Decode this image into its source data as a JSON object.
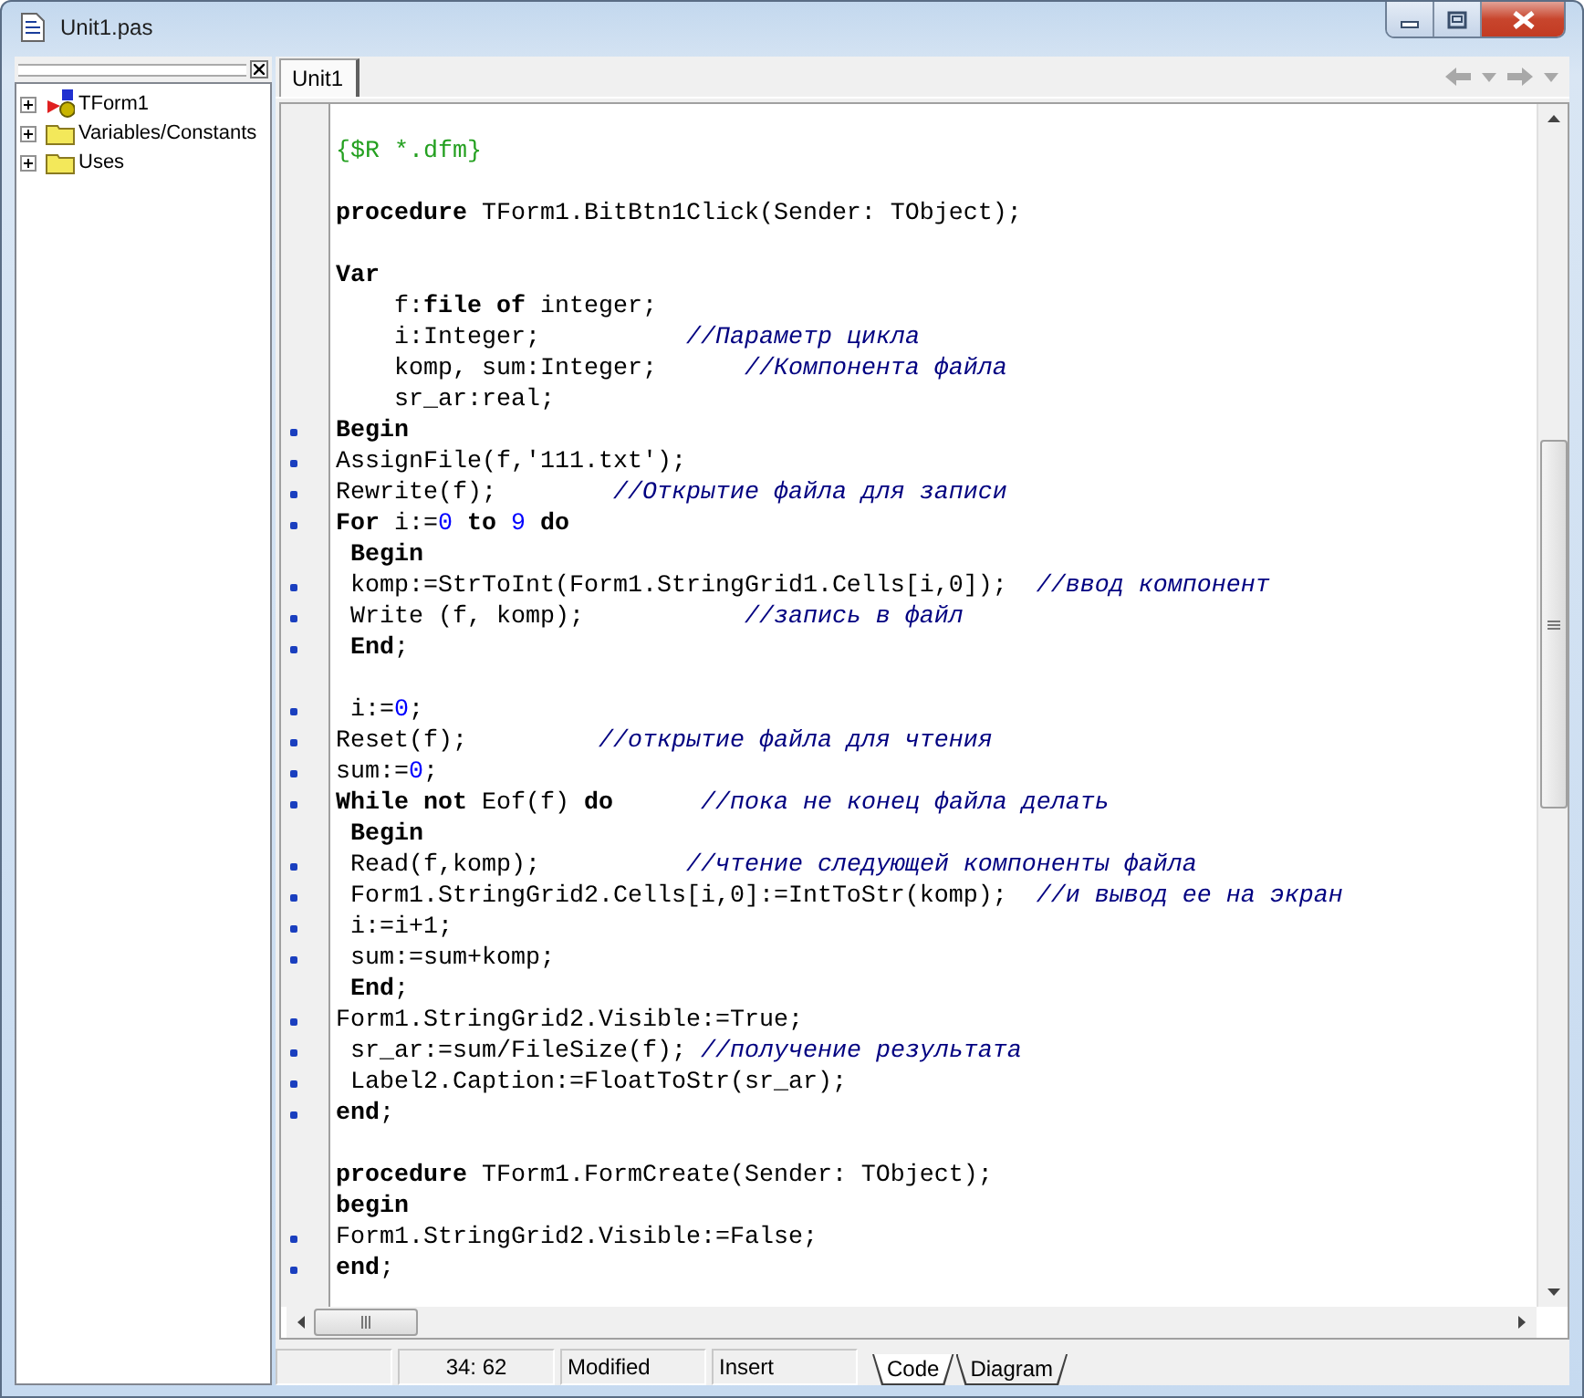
{
  "window": {
    "title": "Unit1.pas"
  },
  "structure_pane": {
    "items": [
      {
        "label": "TForm1",
        "kind": "form",
        "expanded": false
      },
      {
        "label": "Variables/Constants",
        "kind": "folder",
        "expanded": false
      },
      {
        "label": "Uses",
        "kind": "folder",
        "expanded": false
      }
    ]
  },
  "editor": {
    "tabs": [
      {
        "label": "Unit1",
        "selected": true
      }
    ],
    "code_lines": [
      {
        "marked": false
      },
      {
        "marked": false,
        "tokens": [
          {
            "kind": "directive",
            "text": "{$R *.dfm}"
          }
        ]
      },
      {
        "marked": false
      },
      {
        "marked": false,
        "tokens": [
          {
            "kind": "keyword",
            "text": "procedure"
          },
          {
            "kind": "plain",
            "text": " TForm1.BitBtn1Click(Sender: TObject);"
          }
        ]
      },
      {
        "marked": false
      },
      {
        "marked": false,
        "tokens": [
          {
            "kind": "keyword",
            "text": "Var"
          }
        ]
      },
      {
        "marked": false,
        "tokens": [
          {
            "kind": "plain",
            "text": "    f:"
          },
          {
            "kind": "keyword",
            "text": "file of"
          },
          {
            "kind": "plain",
            "text": " integer;"
          }
        ]
      },
      {
        "marked": false,
        "tokens": [
          {
            "kind": "plain",
            "text": "    i:Integer;          "
          },
          {
            "kind": "comment",
            "text": "//Параметр цикла"
          }
        ]
      },
      {
        "marked": false,
        "tokens": [
          {
            "kind": "plain",
            "text": "    komp, sum:Integer;      "
          },
          {
            "kind": "comment",
            "text": "//Компонента файла"
          }
        ]
      },
      {
        "marked": false,
        "tokens": [
          {
            "kind": "plain",
            "text": "    sr_ar:real;"
          }
        ]
      },
      {
        "marked": true,
        "tokens": [
          {
            "kind": "keyword",
            "text": "Begin"
          }
        ]
      },
      {
        "marked": true,
        "tokens": [
          {
            "kind": "plain",
            "text": "AssignFile(f,'111.txt');"
          }
        ]
      },
      {
        "marked": true,
        "tokens": [
          {
            "kind": "plain",
            "text": "Rewrite(f);        "
          },
          {
            "kind": "comment",
            "text": "//Открытие файла для записи"
          }
        ]
      },
      {
        "marked": true,
        "tokens": [
          {
            "kind": "keyword",
            "text": "For"
          },
          {
            "kind": "plain",
            "text": " i:="
          },
          {
            "kind": "number",
            "text": "0"
          },
          {
            "kind": "keyword",
            "text": " to "
          },
          {
            "kind": "number",
            "text": "9"
          },
          {
            "kind": "keyword",
            "text": " do"
          }
        ]
      },
      {
        "marked": false,
        "tokens": [
          {
            "kind": "keyword",
            "text": " Begin"
          }
        ]
      },
      {
        "marked": true,
        "tokens": [
          {
            "kind": "plain",
            "text": " komp:=StrToInt(Form1.StringGrid1.Cells[i,0]);  "
          },
          {
            "kind": "comment",
            "text": "//ввод компонент"
          }
        ]
      },
      {
        "marked": true,
        "tokens": [
          {
            "kind": "plain",
            "text": " Write (f, komp);           "
          },
          {
            "kind": "comment",
            "text": "//запись в файл"
          }
        ]
      },
      {
        "marked": true,
        "tokens": [
          {
            "kind": "keyword",
            "text": " End"
          },
          {
            "kind": "plain",
            "text": ";"
          }
        ]
      },
      {
        "marked": false
      },
      {
        "marked": true,
        "tokens": [
          {
            "kind": "plain",
            "text": " i:="
          },
          {
            "kind": "number",
            "text": "0"
          },
          {
            "kind": "plain",
            "text": ";"
          }
        ]
      },
      {
        "marked": true,
        "tokens": [
          {
            "kind": "plain",
            "text": "Reset(f);         "
          },
          {
            "kind": "comment",
            "text": "//открытие файла для чтения"
          }
        ]
      },
      {
        "marked": true,
        "tokens": [
          {
            "kind": "plain",
            "text": "sum:="
          },
          {
            "kind": "number",
            "text": "0"
          },
          {
            "kind": "plain",
            "text": ";"
          }
        ]
      },
      {
        "marked": true,
        "tokens": [
          {
            "kind": "keyword",
            "text": "While not"
          },
          {
            "kind": "plain",
            "text": " Eof(f) "
          },
          {
            "kind": "keyword",
            "text": "do"
          },
          {
            "kind": "comment",
            "text": "      //пока не конец файла делать"
          }
        ]
      },
      {
        "marked": false,
        "tokens": [
          {
            "kind": "keyword",
            "text": " Begin"
          }
        ]
      },
      {
        "marked": true,
        "tokens": [
          {
            "kind": "plain",
            "text": " Read(f,komp);          "
          },
          {
            "kind": "comment",
            "text": "//чтение следующей компоненты файла"
          }
        ]
      },
      {
        "marked": true,
        "tokens": [
          {
            "kind": "plain",
            "text": " Form1.StringGrid2.Cells[i,0]:=IntToStr(komp);  "
          },
          {
            "kind": "comment",
            "text": "//и вывод ее на экран"
          }
        ]
      },
      {
        "marked": true,
        "tokens": [
          {
            "kind": "plain",
            "text": " i:=i+1;"
          }
        ]
      },
      {
        "marked": true,
        "tokens": [
          {
            "kind": "plain",
            "text": " sum:=sum+komp;"
          }
        ]
      },
      {
        "marked": false,
        "tokens": [
          {
            "kind": "keyword",
            "text": " End"
          },
          {
            "kind": "plain",
            "text": ";"
          }
        ]
      },
      {
        "marked": true,
        "tokens": [
          {
            "kind": "plain",
            "text": "Form1.StringGrid2.Visible:=True;"
          }
        ]
      },
      {
        "marked": true,
        "tokens": [
          {
            "kind": "plain",
            "text": " sr_ar:=sum/FileSize(f); "
          },
          {
            "kind": "comment",
            "text": "//получение результата"
          }
        ]
      },
      {
        "marked": true,
        "tokens": [
          {
            "kind": "plain",
            "text": " Label2.Caption:=FloatToStr(sr_ar);"
          }
        ]
      },
      {
        "marked": true,
        "tokens": [
          {
            "kind": "keyword",
            "text": "end"
          },
          {
            "kind": "plain",
            "text": ";"
          }
        ]
      },
      {
        "marked": false
      },
      {
        "marked": false,
        "tokens": [
          {
            "kind": "keyword",
            "text": "procedure"
          },
          {
            "kind": "plain",
            "text": " TForm1.FormCreate(Sender: TObject);"
          }
        ]
      },
      {
        "marked": false,
        "tokens": [
          {
            "kind": "keyword",
            "text": "begin"
          }
        ]
      },
      {
        "marked": true,
        "tokens": [
          {
            "kind": "plain",
            "text": "Form1.StringGrid2.Visible:=False;"
          }
        ]
      },
      {
        "marked": true,
        "tokens": [
          {
            "kind": "keyword",
            "text": "end"
          },
          {
            "kind": "plain",
            "text": ";"
          }
        ]
      }
    ]
  },
  "status_bar": {
    "cells": [
      "",
      "34: 62",
      "Modified",
      "Insert"
    ],
    "view_tabs": [
      {
        "label": "Code",
        "selected": true
      },
      {
        "label": "Diagram",
        "selected": false
      }
    ]
  }
}
